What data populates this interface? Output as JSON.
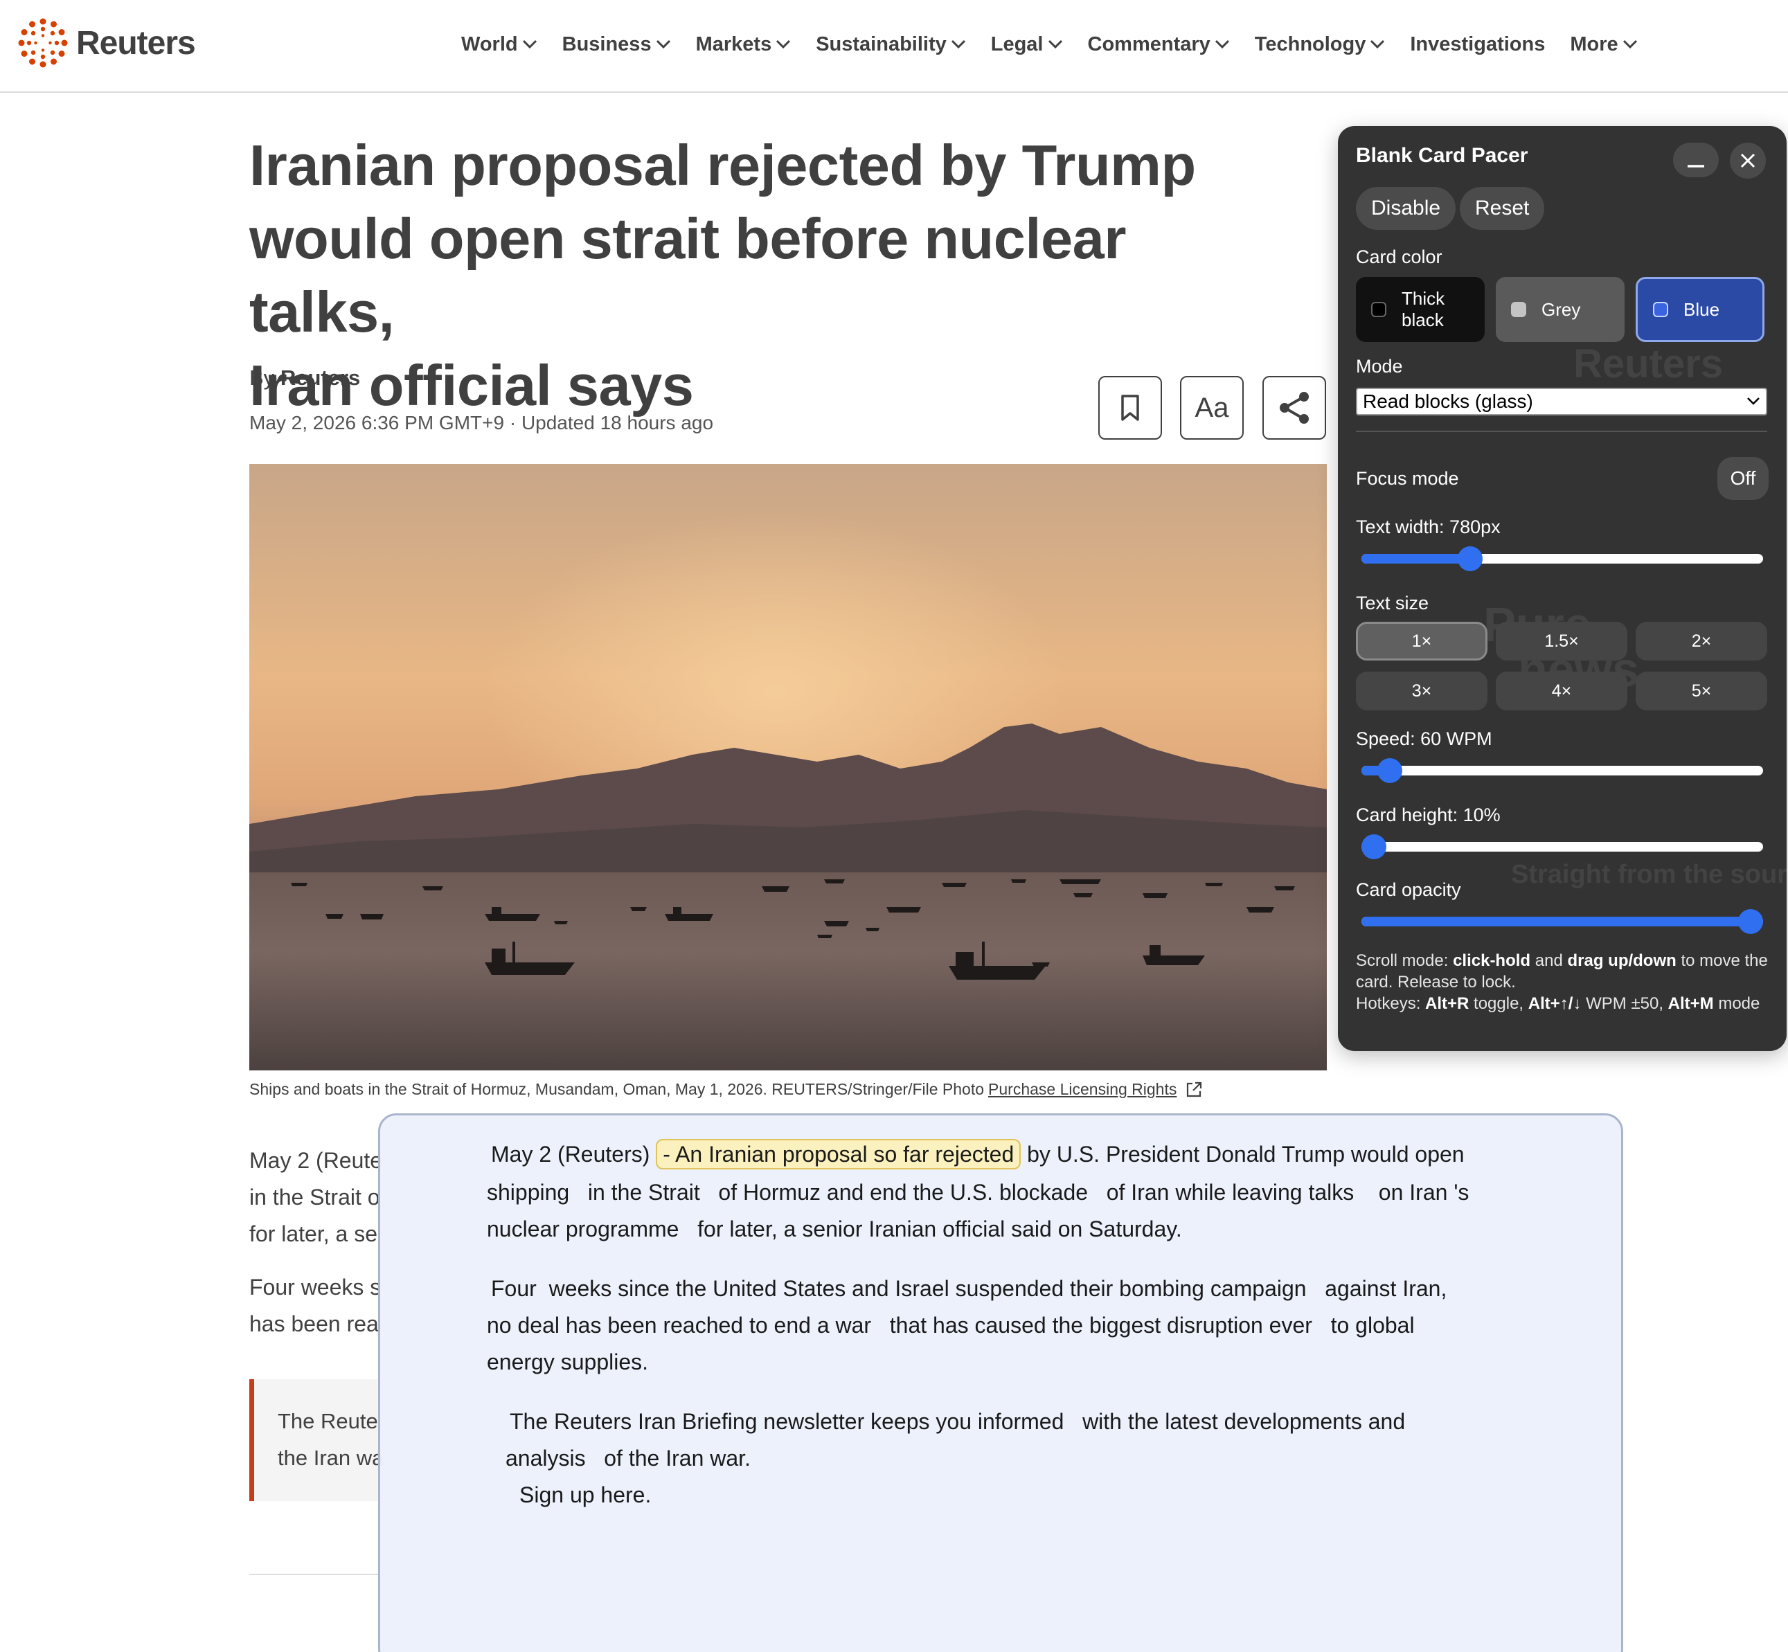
{
  "header": {
    "logo_text": "Reuters",
    "nav": [
      {
        "label": "World",
        "has_menu": true
      },
      {
        "label": "Business",
        "has_menu": true
      },
      {
        "label": "Markets",
        "has_menu": true
      },
      {
        "label": "Sustainability",
        "has_menu": true
      },
      {
        "label": "Legal",
        "has_menu": true
      },
      {
        "label": "Commentary",
        "has_menu": true
      },
      {
        "label": "Technology",
        "has_menu": true
      },
      {
        "label": "Investigations",
        "has_menu": false
      },
      {
        "label": "More",
        "has_menu": true
      }
    ]
  },
  "article": {
    "headline_lines": [
      "Iranian proposal rejected by Trump",
      "would open strait before nuclear talks,",
      "Iran official says"
    ],
    "byline_prefix": "By",
    "byline_author": "Reuters",
    "dateline": "May 2, 2026 6:36 PM GMT+9 · Updated 18 hours ago",
    "tools": {
      "text_size_label": "Aa"
    },
    "photo_caption": "Ships and boats in the Strait of Hormuz, Musandam, Oman, May 1, 2026. REUTERS/Stringer/File Photo",
    "licensing_link": "Purchase Licensing Rights",
    "visible_paragraph_fragments": [
      "May 2 (Reute",
      "in the Strait o",
      "for later, a se",
      "Four weeks s",
      "has been rea"
    ],
    "callout_fragments": [
      "The Reute",
      "the Iran wa"
    ]
  },
  "pacer": {
    "title": "Blank Card Pacer",
    "disable_label": "Disable",
    "reset_label": "Reset",
    "card_color_label": "Card color",
    "colors": [
      {
        "line1": "Thick",
        "line2": "black",
        "hex": "#111111",
        "selected": false
      },
      {
        "line1": "Grey",
        "line2": "",
        "hex": "#5a5a5a",
        "selected": false
      },
      {
        "line1": "Blue",
        "line2": "",
        "hex": "#2b4aa6",
        "selected": true
      }
    ],
    "mode_label": "Mode",
    "mode_value": "Read blocks (glass)",
    "focus_label": "Focus mode",
    "focus_value": "Off",
    "text_width_label": "Text width: 780px",
    "text_width_fraction": 0.27,
    "text_size_label": "Text size",
    "text_sizes": [
      "1×",
      "1.5×",
      "2×",
      "3×",
      "4×",
      "5×"
    ],
    "text_size_selected": "1×",
    "speed_label": "Speed: 60 WPM",
    "speed_fraction": 0.07,
    "card_height_label": "Card height: 10%",
    "card_height_fraction": 0.0,
    "opacity_label": "Card opacity",
    "opacity_fraction": 1.0,
    "help": {
      "scroll_prefix": "Scroll mode: ",
      "click_hold": "click-hold",
      "and": " and ",
      "drag": "drag up/down",
      "scroll_suffix": " to move the card. Release to lock.",
      "hotkeys_prefix": "Hotkeys: ",
      "alt_r": "Alt+R",
      "toggle": " toggle, ",
      "alt_arrows": "Alt+↑/↓",
      "wpm": " WPM ±50, ",
      "alt_m": "Alt+M",
      "mode": " mode"
    },
    "background_fragments": [
      "Reuters",
      "Pure",
      "news",
      "Straight from the sourc"
    ]
  },
  "reading_card": {
    "p1_prefix": "May 2 (Reuters)",
    "p1_highlight": "- An Iranian proposal so far rejected",
    "p1_rest": "by U.S. President Donald Trump would open",
    "p1_line2": "shipping   in the Strait   of Hormuz and end the U.S. blockade   of Iran while leaving talks    on Iran 's",
    "p1_line3": "nuclear programme   for later, a senior Iranian official said on Saturday.",
    "p2_line1": "Four  weeks since the United States and Israel suspended their bombing campaign   against Iran,",
    "p2_line2": "no deal has been reached to end a war   that has caused the biggest disruption ever   to global",
    "p2_line3": "energy supplies.",
    "p3_line1": "The Reuters Iran Briefing newsletter keeps you informed   with the latest developments and",
    "p3_line2": "analysis   of the Iran war.",
    "p3_line3": "Sign up here."
  },
  "colors": {
    "accent": "#c43e1c",
    "text": "#404040",
    "slider": "#2f6ff0",
    "card_bg": "#ecf1fc",
    "highlight": "#fbf1be"
  }
}
